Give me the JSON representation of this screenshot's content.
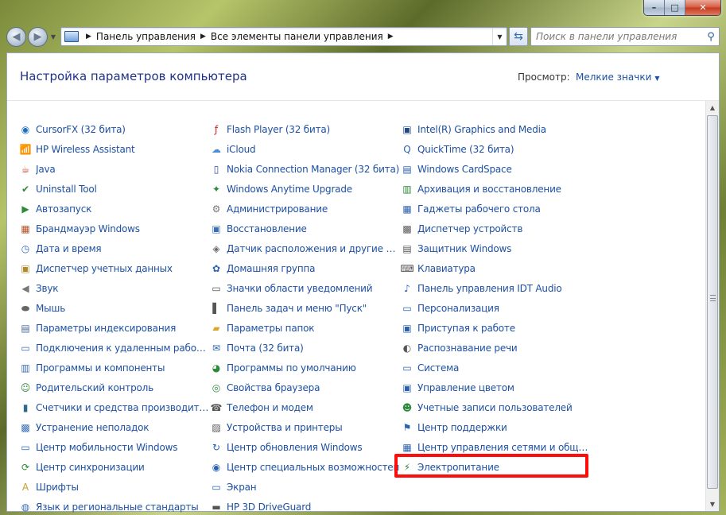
{
  "window": {
    "caption_buttons": [
      "–",
      "□",
      "✕"
    ]
  },
  "toolbar": {
    "back_glyph": "◀",
    "forward_glyph": "▶",
    "breadcrumbs": [
      "Панель управления",
      "Все элементы панели управления"
    ],
    "search_placeholder": "Поиск в панели управления"
  },
  "header": {
    "title": "Настройка параметров компьютера",
    "view_label": "Просмотр:",
    "view_value": "Мелкие значки"
  },
  "items": [
    {
      "label": "CursorFX (32 бита)",
      "icon": "cursor-icon",
      "glyph": "◉",
      "color": "#1f6fbf"
    },
    {
      "label": "HP Wireless Assistant",
      "icon": "wireless-icon",
      "glyph": "📶",
      "color": "#2a62b0"
    },
    {
      "label": "Java",
      "icon": "java-icon",
      "glyph": "☕",
      "color": "#c2412a"
    },
    {
      "label": "Uninstall Tool",
      "icon": "uninstall-icon",
      "glyph": "✔",
      "color": "#2e8a3a"
    },
    {
      "label": "Автозапуск",
      "icon": "autoplay-icon",
      "glyph": "▶",
      "color": "#2e8a3a"
    },
    {
      "label": "Брандмауэр Windows",
      "icon": "firewall-icon",
      "glyph": "▦",
      "color": "#b5542a"
    },
    {
      "label": "Дата и время",
      "icon": "clock-icon",
      "glyph": "◷",
      "color": "#3a6db5"
    },
    {
      "label": "Диспетчер учетных данных",
      "icon": "credentials-icon",
      "glyph": "▣",
      "color": "#b08a2a"
    },
    {
      "label": "Звук",
      "icon": "speaker-icon",
      "glyph": "◀",
      "color": "#777777"
    },
    {
      "label": "Мышь",
      "icon": "mouse-icon",
      "glyph": "⬬",
      "color": "#666666"
    },
    {
      "label": "Параметры индексирования",
      "icon": "indexing-icon",
      "glyph": "▤",
      "color": "#4a6a9a"
    },
    {
      "label": "Подключения к удаленным рабоч...",
      "icon": "remote-desktop-icon",
      "glyph": "▭",
      "color": "#3a6db5"
    },
    {
      "label": "Программы и компоненты",
      "icon": "programs-icon",
      "glyph": "▥",
      "color": "#3a6db5"
    },
    {
      "label": "Родительский контроль",
      "icon": "parental-control-icon",
      "glyph": "☺",
      "color": "#2e8a3a"
    },
    {
      "label": "Счетчики и средства производител...",
      "icon": "performance-icon",
      "glyph": "▮",
      "color": "#2e6a8a"
    },
    {
      "label": "Устранение неполадок",
      "icon": "troubleshoot-icon",
      "glyph": "▩",
      "color": "#3a6db5"
    },
    {
      "label": "Центр мобильности Windows",
      "icon": "mobility-icon",
      "glyph": "▭",
      "color": "#2a62b0"
    },
    {
      "label": "Центр синхронизации",
      "icon": "sync-icon",
      "glyph": "⟳",
      "color": "#2e8a3a"
    },
    {
      "label": "Шрифты",
      "icon": "fonts-icon",
      "glyph": "A",
      "color": "#c2a02a"
    },
    {
      "label": "Язык и региональные стандарты",
      "icon": "region-icon",
      "glyph": "◍",
      "color": "#3a6db5"
    },
    {
      "label": "Flash Player (32 бита)",
      "icon": "flash-icon",
      "glyph": "ƒ",
      "color": "#c8261e"
    },
    {
      "label": "iCloud",
      "icon": "icloud-icon",
      "glyph": "☁",
      "color": "#4a8fd8"
    },
    {
      "label": "Nokia Connection Manager (32 бита)",
      "icon": "nokia-icon",
      "glyph": "▯",
      "color": "#2a4a9a"
    },
    {
      "label": "Windows Anytime Upgrade",
      "icon": "upgrade-icon",
      "glyph": "✦",
      "color": "#2e8a3a"
    },
    {
      "label": "Администрирование",
      "icon": "admin-tools-icon",
      "glyph": "⚙",
      "color": "#777777"
    },
    {
      "label": "Восстановление",
      "icon": "recovery-icon",
      "glyph": "▣",
      "color": "#3a6db5"
    },
    {
      "label": "Датчик расположения и другие дат...",
      "icon": "location-sensor-icon",
      "glyph": "◈",
      "color": "#6a6a6a"
    },
    {
      "label": "Домашняя группа",
      "icon": "homegroup-icon",
      "glyph": "✿",
      "color": "#2a62b0"
    },
    {
      "label": "Значки области уведомлений",
      "icon": "notification-icons-icon",
      "glyph": "▭",
      "color": "#555555"
    },
    {
      "label": "Панель задач и меню \"Пуск\"",
      "icon": "taskbar-icon",
      "glyph": "▌",
      "color": "#555555"
    },
    {
      "label": "Параметры папок",
      "icon": "folder-options-icon",
      "glyph": "▰",
      "color": "#d9a72a"
    },
    {
      "label": "Почта (32 бита)",
      "icon": "mail-icon",
      "glyph": "✉",
      "color": "#2a62b0"
    },
    {
      "label": "Программы по умолчанию",
      "icon": "default-programs-icon",
      "glyph": "◕",
      "color": "#2e8a3a"
    },
    {
      "label": "Свойства браузера",
      "icon": "internet-options-icon",
      "glyph": "◎",
      "color": "#2e8a3a"
    },
    {
      "label": "Телефон и модем",
      "icon": "modem-icon",
      "glyph": "☎",
      "color": "#555555"
    },
    {
      "label": "Устройства и принтеры",
      "icon": "printer-icon",
      "glyph": "▨",
      "color": "#555555"
    },
    {
      "label": "Центр обновления Windows",
      "icon": "windows-update-icon",
      "glyph": "↻",
      "color": "#2a62b0"
    },
    {
      "label": "Центр специальных возможностей",
      "icon": "accessibility-icon",
      "glyph": "◉",
      "color": "#2a62b0"
    },
    {
      "label": "Экран",
      "icon": "display-icon",
      "glyph": "▭",
      "color": "#2a62b0"
    },
    {
      "label": "HP 3D DriveGuard",
      "icon": "driveguard-icon",
      "glyph": "▬",
      "color": "#555555"
    },
    {
      "label": "Intel(R) Graphics and Media",
      "icon": "intel-graphics-icon",
      "glyph": "▣",
      "color": "#1f4a8a"
    },
    {
      "label": "QuickTime (32 бита)",
      "icon": "quicktime-icon",
      "glyph": "Q",
      "color": "#2a62b0"
    },
    {
      "label": "Windows CardSpace",
      "icon": "cardspace-icon",
      "glyph": "▤",
      "color": "#2a62b0"
    },
    {
      "label": "Архивация и восстановление",
      "icon": "backup-icon",
      "glyph": "▥",
      "color": "#2e8a3a"
    },
    {
      "label": "Гаджеты рабочего стола",
      "icon": "gadgets-icon",
      "glyph": "▦",
      "color": "#2a62b0"
    },
    {
      "label": "Диспетчер устройств",
      "icon": "device-manager-icon",
      "glyph": "▩",
      "color": "#555555"
    },
    {
      "label": "Защитник Windows",
      "icon": "defender-icon",
      "glyph": "▤",
      "color": "#555555"
    },
    {
      "label": "Клавиатура",
      "icon": "keyboard-icon",
      "glyph": "⌨",
      "color": "#555555"
    },
    {
      "label": "Панель управления IDT Audio",
      "icon": "idt-audio-icon",
      "glyph": "♪",
      "color": "#2a62b0"
    },
    {
      "label": "Персонализация",
      "icon": "personalization-icon",
      "glyph": "▭",
      "color": "#2a62b0"
    },
    {
      "label": "Приступая к работе",
      "icon": "getting-started-icon",
      "glyph": "▣",
      "color": "#2a62b0"
    },
    {
      "label": "Распознавание речи",
      "icon": "microphone-icon",
      "glyph": "◐",
      "color": "#555555"
    },
    {
      "label": "Система",
      "icon": "system-icon",
      "glyph": "▭",
      "color": "#2a62b0"
    },
    {
      "label": "Управление цветом",
      "icon": "color-management-icon",
      "glyph": "▣",
      "color": "#2a62b0"
    },
    {
      "label": "Учетные записи пользователей",
      "icon": "user-accounts-icon",
      "glyph": "☻",
      "color": "#2e8a3a"
    },
    {
      "label": "Центр поддержки",
      "icon": "flag-icon",
      "glyph": "⚑",
      "color": "#2a62b0"
    },
    {
      "label": "Центр управления сетями и общи...",
      "icon": "network-center-icon",
      "glyph": "▦",
      "color": "#2a62b0"
    },
    {
      "label": "Электропитание",
      "icon": "power-options-icon",
      "glyph": "⚡",
      "color": "#2e8a3a"
    }
  ]
}
